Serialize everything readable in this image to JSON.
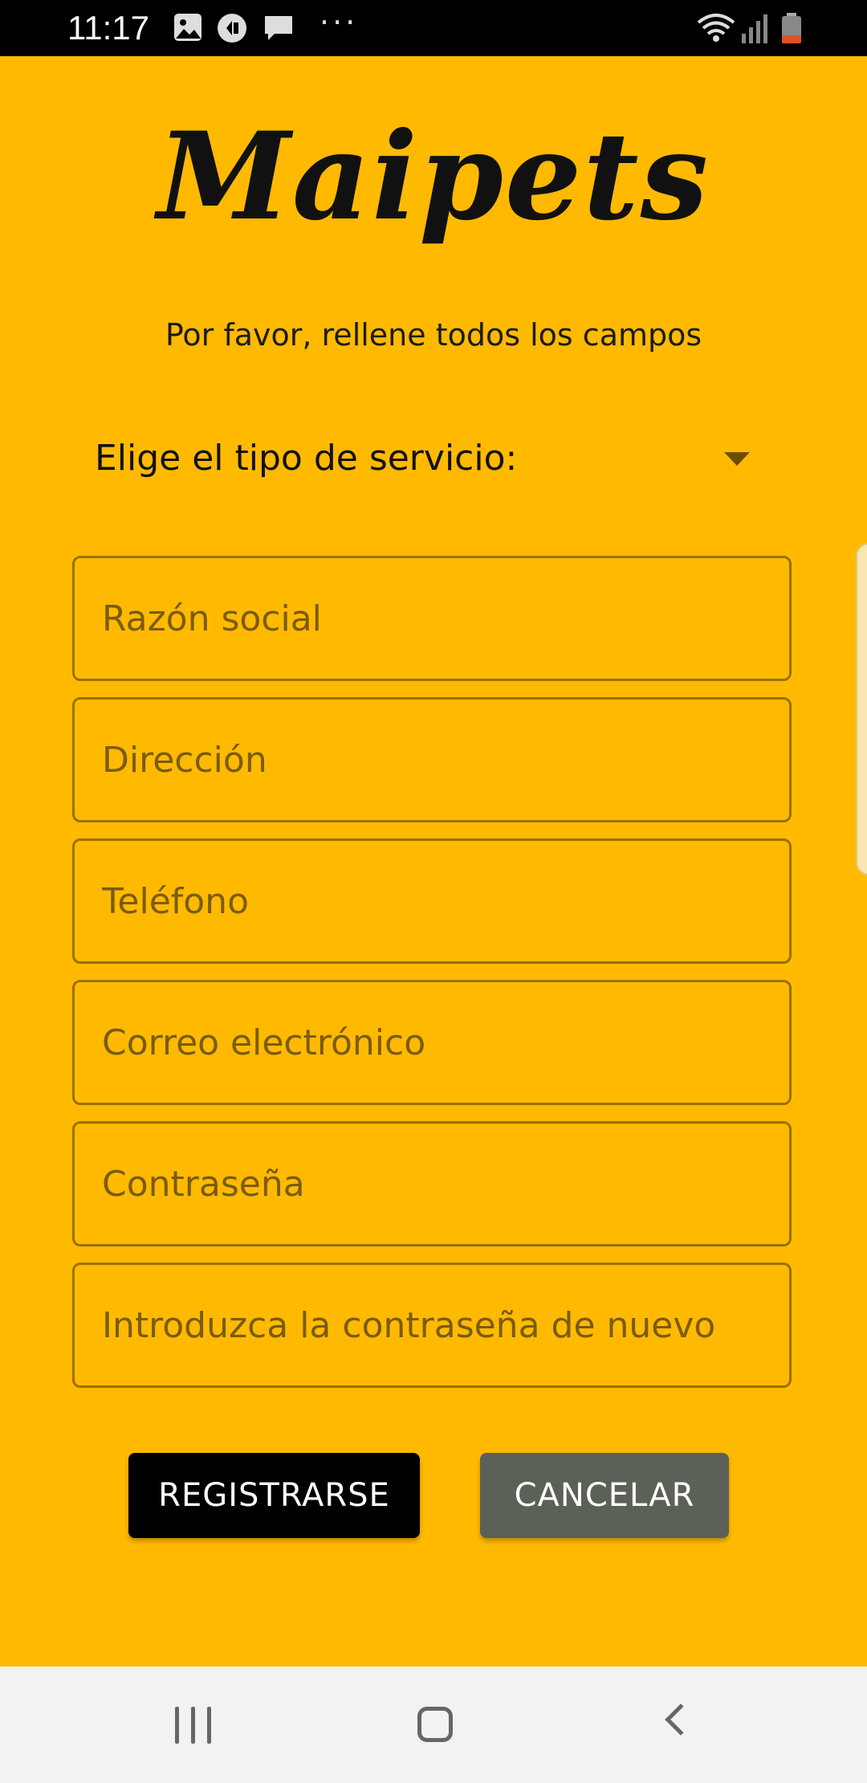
{
  "status_bar": {
    "time": "11:17",
    "dots": "···",
    "icons": [
      "image-icon",
      "vpn-icon",
      "message-icon",
      "wifi-icon",
      "signal-icon",
      "battery-icon"
    ]
  },
  "app": {
    "logo": "Maipets",
    "subtitle": "Por favor, rellene todos los campos",
    "service_spinner": {
      "label": "Elige el tipo de servicio:"
    },
    "fields": {
      "business_name": {
        "placeholder": "Razón social",
        "value": ""
      },
      "address": {
        "placeholder": "Dirección",
        "value": ""
      },
      "phone": {
        "placeholder": "Teléfono",
        "value": ""
      },
      "email": {
        "placeholder": "Correo electrónico",
        "value": ""
      },
      "password": {
        "placeholder": "Contraseña",
        "value": ""
      },
      "password_repeat": {
        "placeholder": "Introduzca la contraseña de nuevo",
        "value": ""
      }
    },
    "buttons": {
      "register": "REGISTRARSE",
      "cancel": "CANCELAR"
    }
  },
  "colors": {
    "background": "#FFBA00",
    "register_button": "#000000",
    "cancel_button": "#5C6157"
  },
  "nav_bar": {
    "icons": [
      "recent-apps-icon",
      "home-icon",
      "back-icon"
    ]
  }
}
